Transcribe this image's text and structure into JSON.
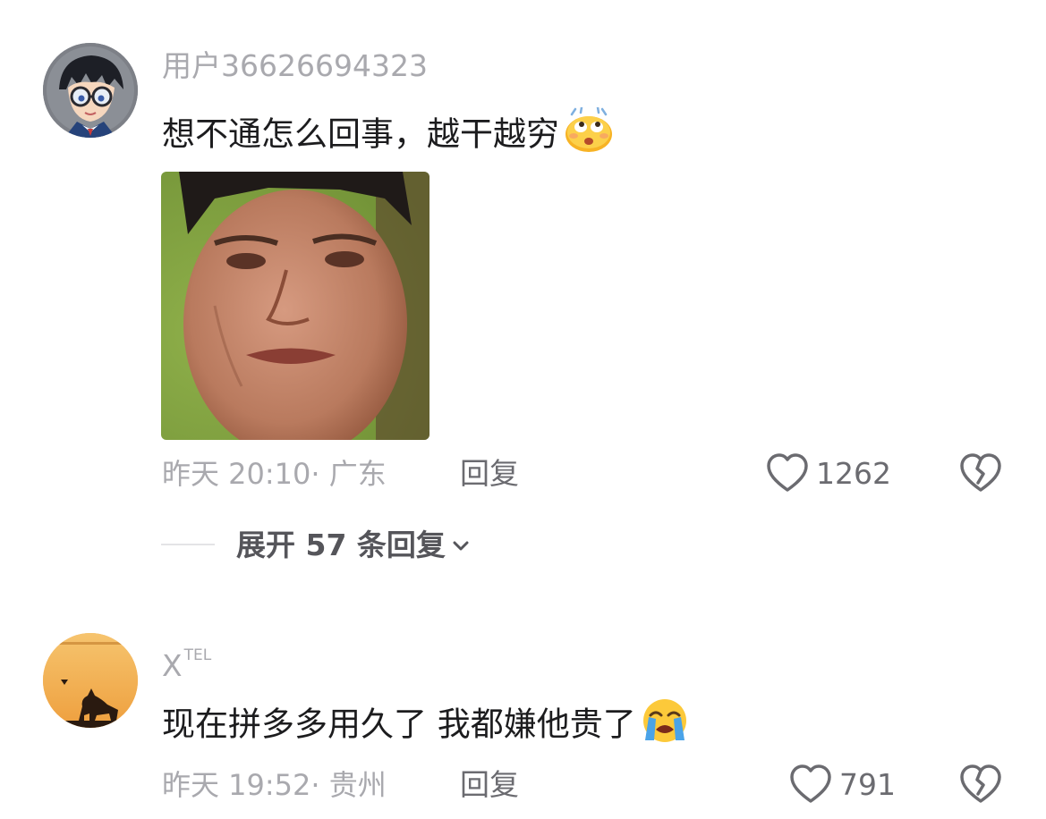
{
  "comments": [
    {
      "username": "用户36626694323",
      "text": "想不通怎么回事，越干越穷",
      "emoji": "face-with-rolling-eyes-and-sweat-emoji",
      "time": "昨天 20:10",
      "location": "· 广东",
      "reply_label": "回复",
      "likes": "1262",
      "avatar": "anime-boy-with-glasses-avatar"
    },
    {
      "username": "X",
      "username_sup": "TEL",
      "text": "现在拼多多用久了 我都嫌他贵了",
      "emoji": "loudly-crying-face-emoji",
      "time": "昨天 19:52",
      "location": "· 贵州",
      "reply_label": "回复",
      "likes": "791",
      "avatar": "sunset-dog-silhouette-avatar"
    }
  ],
  "expand_replies": "展开 57 条回复",
  "colors": {
    "secondary_text": "#a9a9ae",
    "primary_text": "#1c1c1e",
    "action_text": "#6b6b70",
    "avatar2_bg": "#f3b25a"
  }
}
